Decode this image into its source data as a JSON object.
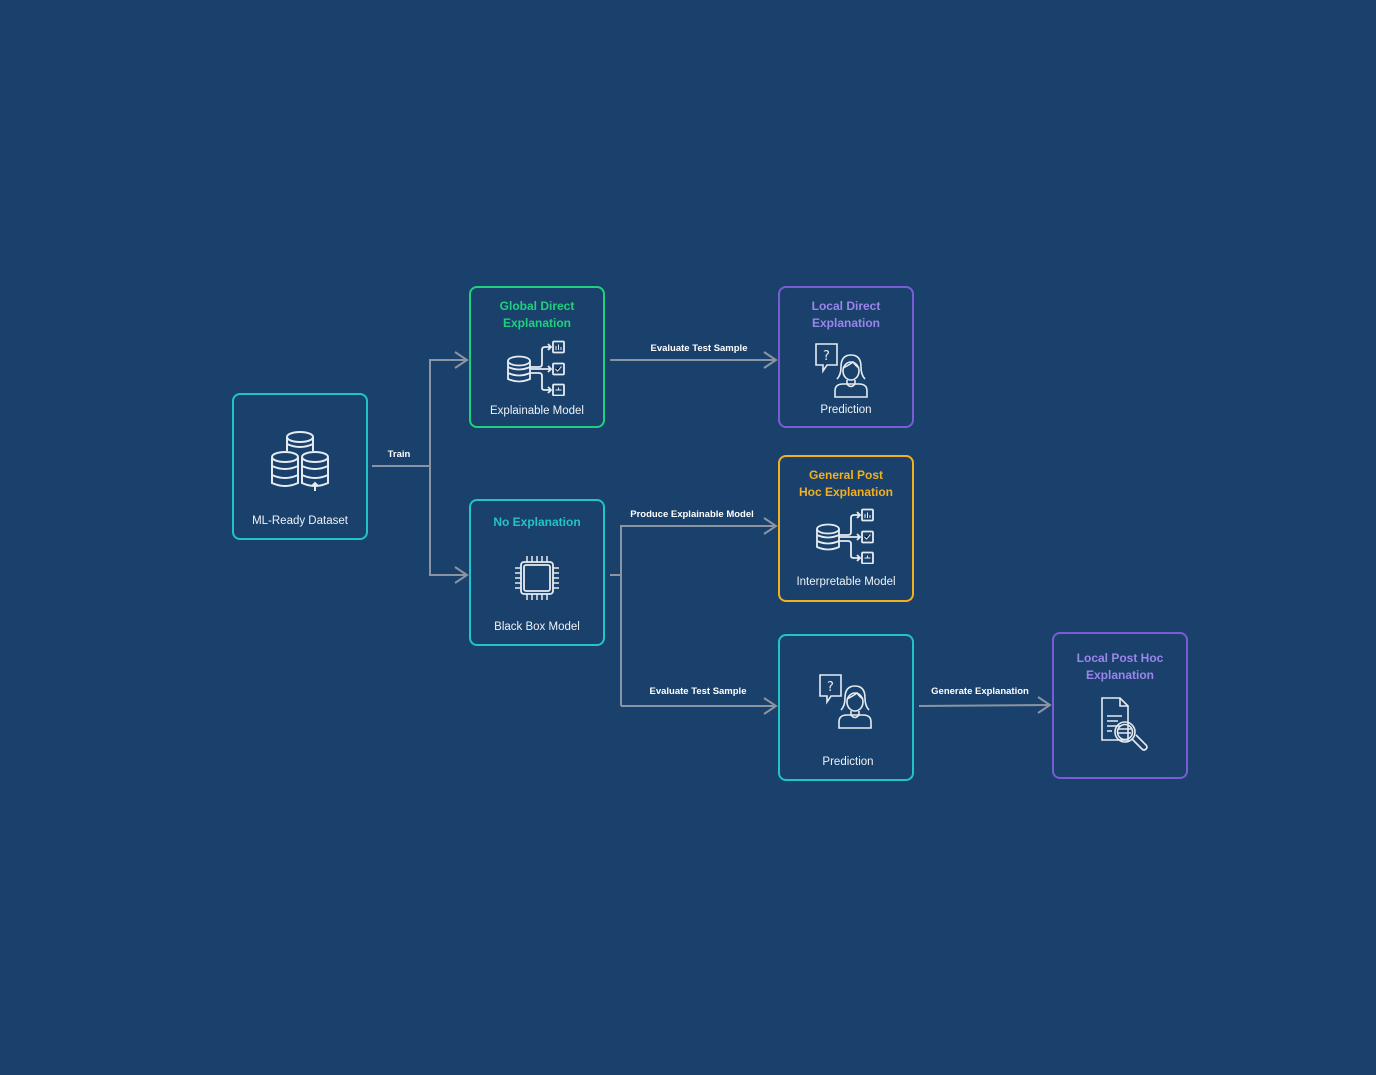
{
  "diagram": {
    "background_color": "#1a416b",
    "edge_color": "#8a94a3",
    "nodes": {
      "dataset": {
        "title": "",
        "label": "ML-Ready Dataset",
        "border_color": "#22c3c9",
        "icon": "database-stack-icon"
      },
      "global_direct": {
        "title": "Global Direct Explanation",
        "label": "Explainable Model",
        "border_color": "#1fd17f",
        "title_color": "#1fd17f",
        "icon": "database-to-charts-icon"
      },
      "no_explanation": {
        "title": "No Explanation",
        "label": "Black Box Model",
        "border_color": "#22c3c9",
        "title_color": "#22c3c9",
        "icon": "chip-icon"
      },
      "local_direct": {
        "title": "Local Direct Explanation",
        "label": "Prediction",
        "border_color": "#7a5cd6",
        "title_color": "#9b85ec",
        "icon": "person-question-icon"
      },
      "general_post_hoc": {
        "title": "General Post Hoc Explanation",
        "label": "Interpretable Model",
        "border_color": "#f2b01e",
        "title_color": "#f2b01e",
        "icon": "database-to-charts-icon"
      },
      "prediction": {
        "title": "",
        "label": "Prediction",
        "border_color": "#22c3c9",
        "icon": "person-question-icon"
      },
      "local_post_hoc": {
        "title": "Local Post Hoc Explanation",
        "label": "",
        "border_color": "#7a5cd6",
        "title_color": "#9b85ec",
        "icon": "document-search-icon"
      }
    },
    "edges": [
      {
        "from": "dataset",
        "to": "global_direct",
        "label": "Train"
      },
      {
        "from": "dataset",
        "to": "no_explanation",
        "label": ""
      },
      {
        "from": "global_direct",
        "to": "local_direct",
        "label": "Evaluate Test Sample"
      },
      {
        "from": "no_explanation",
        "to": "general_post_hoc",
        "label": "Produce Explainable Model"
      },
      {
        "from": "no_explanation",
        "to": "prediction",
        "label": "Evaluate Test Sample"
      },
      {
        "from": "prediction",
        "to": "local_post_hoc",
        "label": "Generate Explanation"
      }
    ]
  }
}
